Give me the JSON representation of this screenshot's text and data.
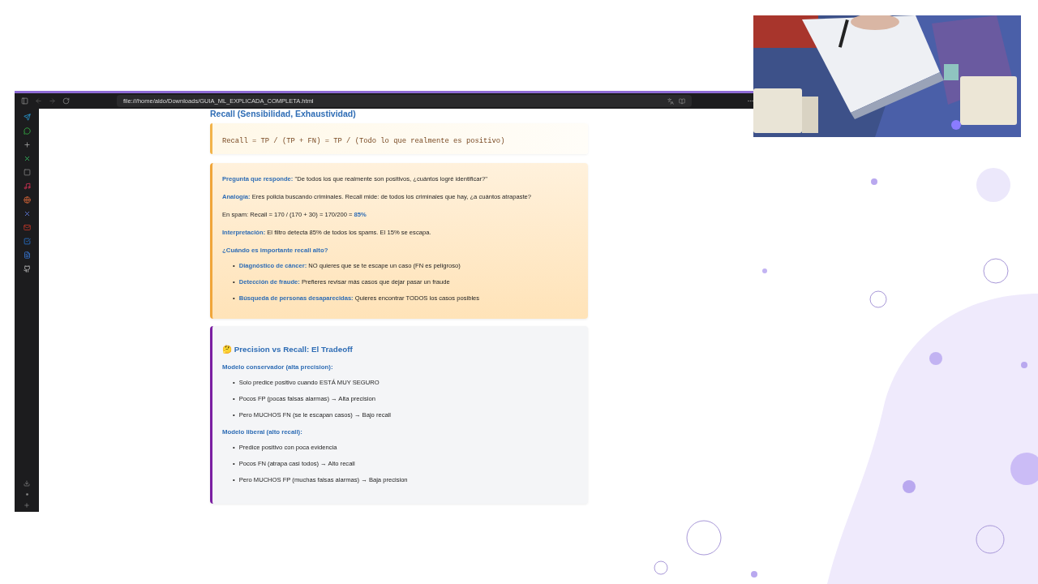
{
  "browser": {
    "url": "file:///home/aldo/Downloads/GUIA_ML_EXPLICADA_COMPLETA.html"
  },
  "page": {
    "section_title": "Recall (Sensibilidad, Exhaustividad)",
    "formula": "Recall = TP / (TP + FN) = TP / (Todo lo que realmente es positivo)",
    "recall_card": {
      "paragraphs": [
        {
          "label": "Pregunta que responde:",
          "text": " \"De todos los que realmente son positivos, ¿cuántos logré identificar?\""
        },
        {
          "label": "Analogía:",
          "text": " Eres policia buscando criminales. Recall mide: de todos los criminales que hay, ¿a cuántos atrapaste?"
        },
        {
          "text": "En spam: Recall = 170 / (170 + 30) = 170/200 = ",
          "highlight": "85%"
        },
        {
          "label": "Interpretación:",
          "text": " El filtro detecta 85% de todos los spams. El 15% se escapa."
        }
      ],
      "question": "¿Cuándo es importante recall alto?",
      "marker": "•",
      "bullets": [
        {
          "label": "Diagnóstico de cáncer:",
          "text": " NO quieres que se te escape un caso (FN es peligroso)"
        },
        {
          "label": "Detección de fraude:",
          "text": " Prefieres revisar más casos que dejar pasar un fraude"
        },
        {
          "label": "Búsqueda de personas desaparecidas:",
          "text": " Quieres encontrar TODOS los casos posibles"
        }
      ]
    },
    "tradeoff_card": {
      "emoji": "🤔",
      "marker": "•",
      "title": "Precision vs Recall: El Tradeoff",
      "groups": [
        {
          "heading": "Modelo conservador (alta precision):",
          "items": [
            "Solo predice positivo cuando ESTÁ MUY SEGURO",
            "Pocos FP (pocas falsas alarmas) → Alta precision",
            "Pero MUCHOS FN (se le escapan casos) → Bajo recall"
          ]
        },
        {
          "heading": "Modelo liberal (alto recall):",
          "items": [
            "Predice positivo con poca evidencia",
            "Pocos FN (atrapa casi todos) → Alto recall",
            "Pero MUCHOS FP (muchas falsas alarmas) → Baja precision"
          ]
        }
      ]
    }
  }
}
